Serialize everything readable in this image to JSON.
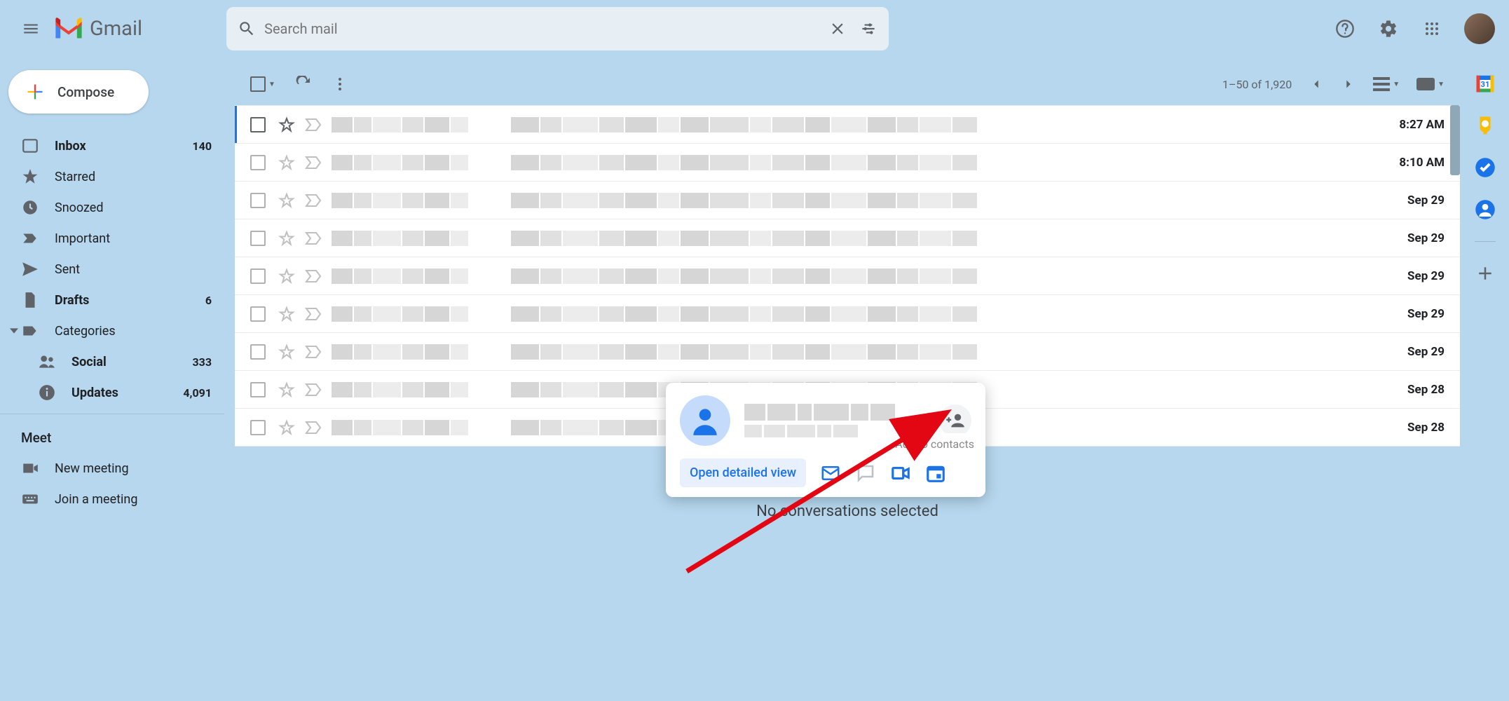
{
  "header": {
    "app_name": "Gmail",
    "search_placeholder": "Search mail"
  },
  "compose": {
    "label": "Compose"
  },
  "nav": [
    {
      "icon": "inbox",
      "label": "Inbox",
      "count": "140",
      "bold": true
    },
    {
      "icon": "star",
      "label": "Starred"
    },
    {
      "icon": "clock",
      "label": "Snoozed"
    },
    {
      "icon": "important",
      "label": "Important"
    },
    {
      "icon": "send",
      "label": "Sent"
    },
    {
      "icon": "file",
      "label": "Drafts",
      "count": "6",
      "bold": true
    },
    {
      "icon": "label",
      "label": "Categories",
      "expand": true
    }
  ],
  "categories": [
    {
      "icon": "people",
      "label": "Social",
      "count": "333",
      "bold": true
    },
    {
      "icon": "info",
      "label": "Updates",
      "count": "4,091",
      "bold": true
    }
  ],
  "meet": {
    "header": "Meet",
    "items": [
      {
        "icon": "video",
        "label": "New meeting"
      },
      {
        "icon": "keyboard",
        "label": "Join a meeting"
      }
    ]
  },
  "toolbar": {
    "range": "1–50 of 1,920"
  },
  "emails": [
    {
      "date": "8:27 AM",
      "active": true
    },
    {
      "date": "8:10 AM"
    },
    {
      "date": "Sep 29"
    },
    {
      "date": "Sep 29"
    },
    {
      "date": "Sep 29"
    },
    {
      "date": "Sep 29"
    },
    {
      "date": "Sep 29"
    },
    {
      "date": "Sep 28"
    },
    {
      "date": "Sep 28"
    }
  ],
  "contact_card": {
    "detailed_view": "Open detailed view",
    "tooltip": "Add to contacts"
  },
  "status": {
    "no_selection": "No conversations selected"
  }
}
